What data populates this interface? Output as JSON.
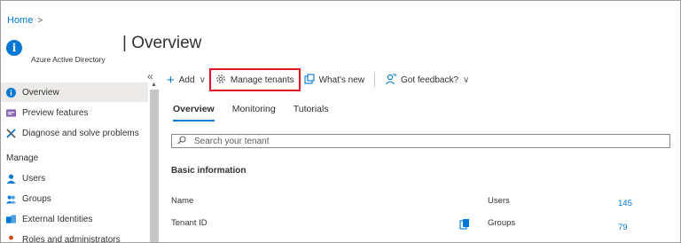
{
  "breadcrumb": {
    "home": "Home"
  },
  "header": {
    "title": "| Overview",
    "subtitle": "Azure Active Directory",
    "icon": "info-icon"
  },
  "sidebar": {
    "collapse_label": "«",
    "items": [
      {
        "label": "Overview",
        "icon": "info-icon",
        "active": true
      },
      {
        "label": "Preview features",
        "icon": "preview-icon"
      },
      {
        "label": "Diagnose and solve problems",
        "icon": "wrench-icon"
      }
    ],
    "section_label": "Manage",
    "manage_items": [
      {
        "label": "Users",
        "icon": "user-icon"
      },
      {
        "label": "Groups",
        "icon": "groups-icon"
      },
      {
        "label": "External Identities",
        "icon": "external-identities-icon"
      },
      {
        "label": "Roles and administrators",
        "icon": "roles-icon"
      }
    ]
  },
  "toolbar": {
    "add_label": "Add",
    "manage_tenants_label": "Manage tenants",
    "whats_new_label": "What's new",
    "feedback_label": "Got feedback?"
  },
  "tabs": [
    "Overview",
    "Monitoring",
    "Tutorials"
  ],
  "search": {
    "placeholder": "Search your tenant"
  },
  "basic_info": {
    "title": "Basic information",
    "left": [
      {
        "label": "Name"
      },
      {
        "label": "Tenant ID"
      }
    ],
    "right": [
      {
        "label": "Users",
        "value": "145"
      },
      {
        "label": "Groups",
        "value": "79"
      }
    ]
  },
  "colors": {
    "accent": "#0078d4",
    "highlight_border": "#e81123",
    "active_nav": "#edebe9"
  }
}
